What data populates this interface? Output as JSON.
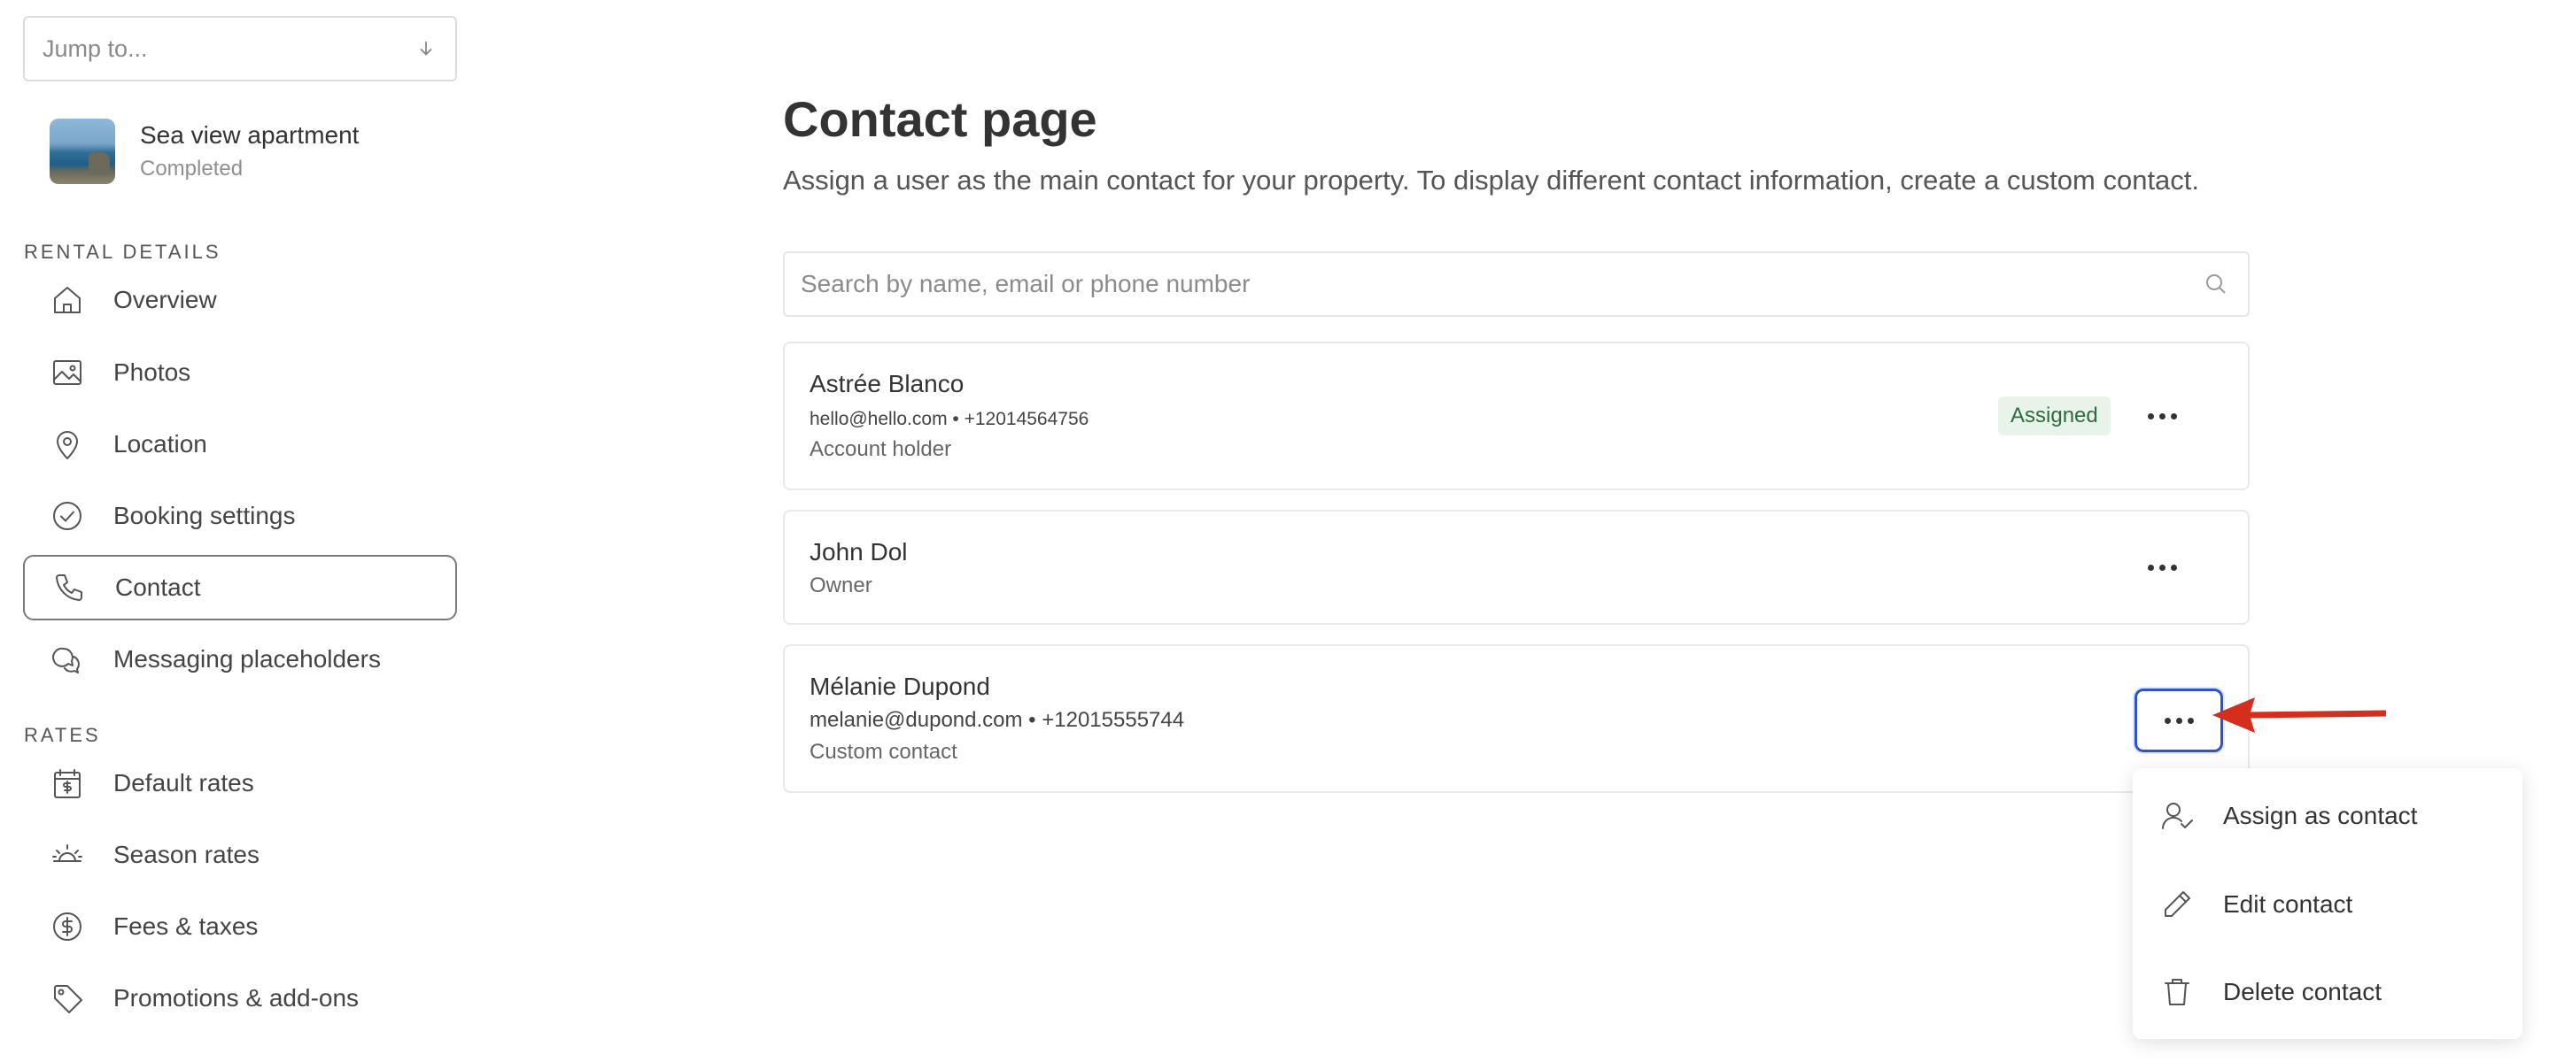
{
  "sidebar": {
    "jump_placeholder": "Jump to...",
    "property": {
      "title": "Sea view apartment",
      "status": "Completed"
    },
    "sections": [
      {
        "title": "RENTAL DETAILS",
        "items": [
          {
            "label": "Overview",
            "icon": "home-icon"
          },
          {
            "label": "Photos",
            "icon": "image-icon"
          },
          {
            "label": "Location",
            "icon": "location-pin-icon"
          },
          {
            "label": "Booking settings",
            "icon": "check-circle-icon"
          },
          {
            "label": "Contact",
            "icon": "phone-icon",
            "active": true
          },
          {
            "label": "Messaging placeholders",
            "icon": "chat-bubbles-icon"
          }
        ]
      },
      {
        "title": "RATES",
        "items": [
          {
            "label": "Default rates",
            "icon": "calendar-dollar-icon"
          },
          {
            "label": "Season rates",
            "icon": "sun-icon"
          },
          {
            "label": "Fees & taxes",
            "icon": "dollar-circle-icon"
          },
          {
            "label": "Promotions & add-ons",
            "icon": "tag-icon"
          }
        ]
      }
    ]
  },
  "main": {
    "title": "Contact page",
    "description": "Assign a user as the main contact for your property. To display different contact information, create a custom contact.",
    "search_placeholder": "Search by name, email or phone number",
    "contacts": [
      {
        "name": "Astrée Blanco",
        "details": "hello@hello.com • +12014564756",
        "role": "Account holder",
        "badge": "Assigned"
      },
      {
        "name": "John Dol",
        "role": "Owner"
      },
      {
        "name": "Mélanie Dupond",
        "details": "melanie@dupond.com • +12015555744",
        "role": "Custom contact"
      }
    ]
  },
  "context_menu": {
    "items": [
      {
        "label": "Assign as contact",
        "icon": "assign-user-icon"
      },
      {
        "label": "Edit contact",
        "icon": "pencil-icon"
      },
      {
        "label": "Delete contact",
        "icon": "trash-icon"
      }
    ]
  },
  "annotation": {
    "arrow_color": "#d32f1c"
  },
  "colors": {
    "focus_ring": "#3153c7",
    "badge_bg": "#e8f3ea",
    "badge_text": "#2e6b3f"
  }
}
